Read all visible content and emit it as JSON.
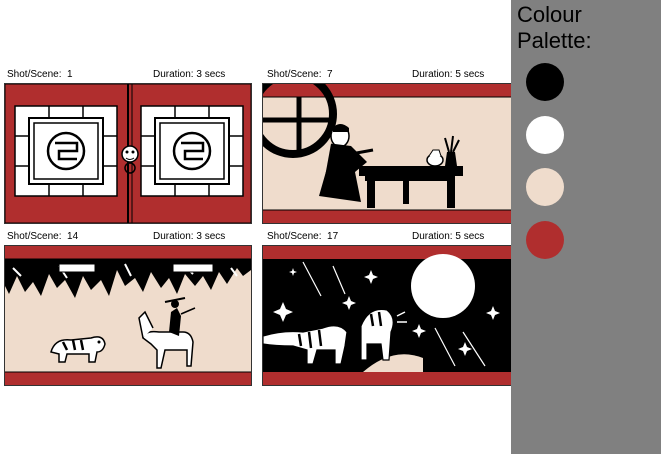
{
  "storyboard": {
    "shot_label": "Shot/Scene:",
    "duration_label": "Duration:",
    "panels": [
      {
        "shot": "1",
        "duration": "3 secs"
      },
      {
        "shot": "7",
        "duration": "5 secs"
      },
      {
        "shot": "14",
        "duration": "3 secs"
      },
      {
        "shot": "17",
        "duration": "5 secs"
      }
    ]
  },
  "palette": {
    "title": "Colour Palette:",
    "colors": [
      "#000000",
      "#ffffff",
      "#efdccc",
      "#b02e2e"
    ]
  }
}
